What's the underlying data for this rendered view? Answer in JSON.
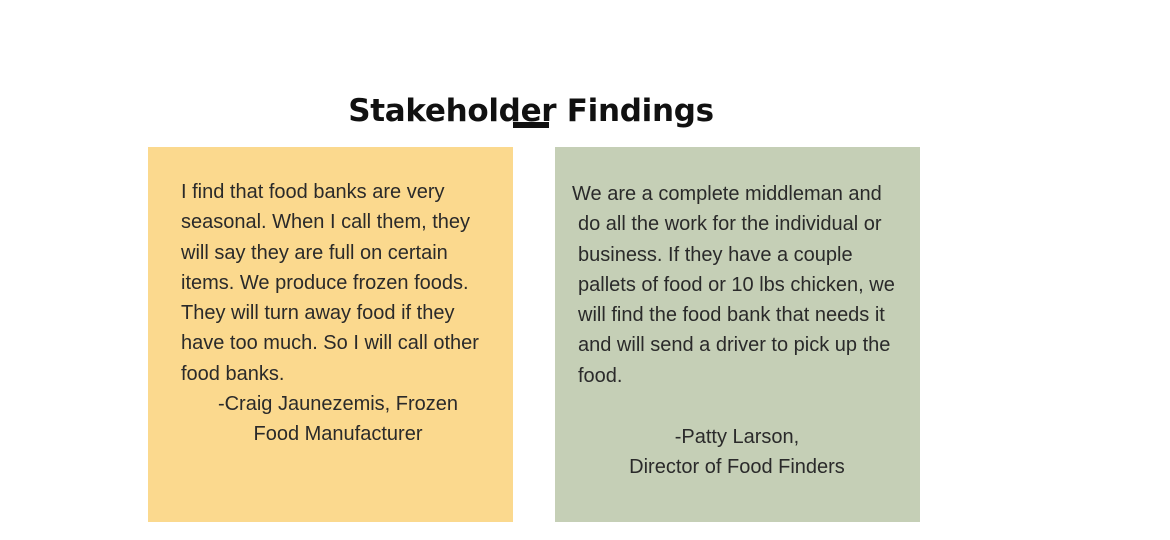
{
  "page": {
    "title": "Stakeholder Findings"
  },
  "cards": [
    {
      "quote": "I find that food banks are very seasonal. When I call them, they will say they are full on certain items. We produce frozen foods. They will turn away food if they have too much. So I will call other food banks.",
      "attribution_line1": "-Craig Jaunezemis, Frozen",
      "attribution_line2": "Food Manufacturer",
      "background": "#fbd98e"
    },
    {
      "quote": " We are a complete middleman and do all the work for the individual or business. If they have a couple pallets of food or 10 lbs chicken, we will find the food bank that needs it and will send a driver to pick up the food.",
      "attribution_line1": "-Patty Larson,",
      "attribution_line2": "Director of Food Finders",
      "background": "#c5cfb6"
    }
  ]
}
